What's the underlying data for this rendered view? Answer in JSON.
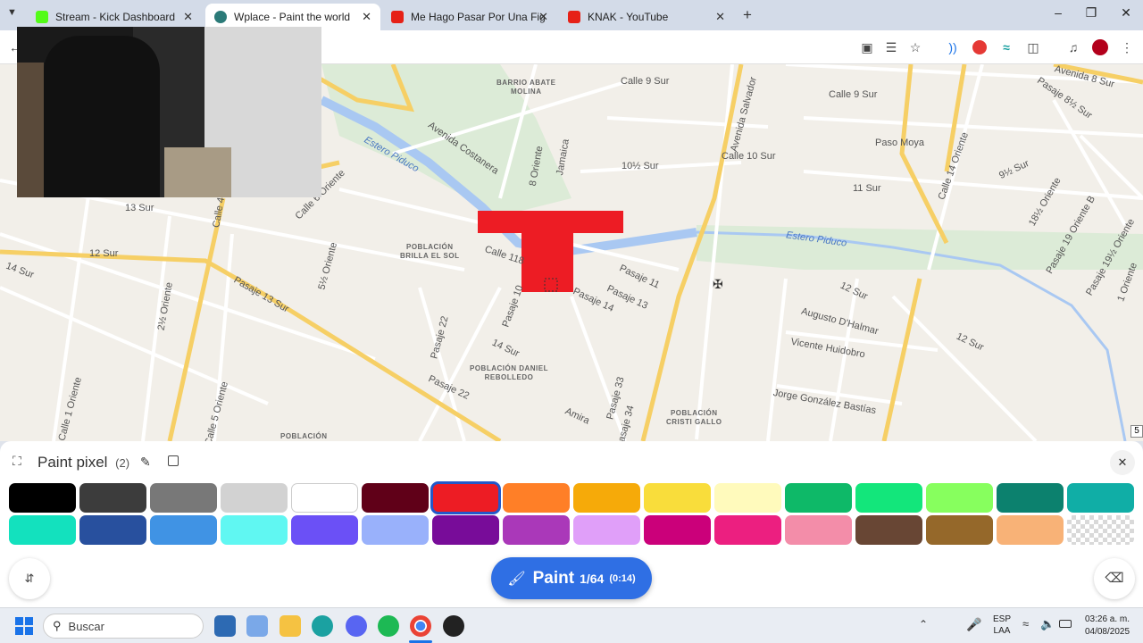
{
  "tabs": [
    {
      "title": "Stream - Kick Dashboard",
      "icon": "kick-icon",
      "color": "#53fc18",
      "active": false
    },
    {
      "title": "Wplace - Paint the world",
      "icon": "globe-icon",
      "color": "#2b7a78",
      "active": true
    },
    {
      "title": "Me Hago Pasar Por Una Figura",
      "icon": "youtube-icon",
      "color": "#e62117",
      "active": false
    },
    {
      "title": "KNAK - YouTube",
      "icon": "youtube-icon",
      "color": "#e62117",
      "active": false
    }
  ],
  "map": {
    "streets": [
      "Calle 9 Sur",
      "Calle 9 Sur",
      "Avenida 8 Sur",
      "Pasaje 8½ Sur",
      "Avenida Costanera",
      "8 Oriente",
      "Jamaica",
      "10½ Sur",
      "Calle 10 Sur",
      "Paso Moya",
      "Calle 14 Oriente",
      "9½ Sur",
      "11 Sur",
      "Calle 6 Oriente",
      "Calle 4",
      "13 Sur",
      "12 Sur",
      "Calle 118",
      "5½ Oriente",
      "Pasaje 13 Sur",
      "2½ Oriente",
      "14 Sur",
      "Pasaje 10",
      "Pasaje 14",
      "Pasaje 11",
      "Pasaje 13",
      "12 Sur",
      "Augusto D'Halmar",
      "Vicente Huidobro",
      "Jorge González Bastías",
      "Pasaje 22",
      "14 Sur",
      "Pasaje 22",
      "Pasaje 33",
      "Amira",
      "Pasaje 34",
      "Calle 5 Oriente",
      "Calle 1 Oriente",
      "Estero Piduco",
      "Estero Piduco",
      "Avenida Salvador",
      "18½ Oriente",
      "Pasaje 19 Oriente B",
      "Pasaje 19½ Oriente",
      "1 Oriente",
      "12 Sur"
    ],
    "neighborhoods": [
      "BARRIO ABATE\nMOLINA",
      "POBLACIÓN\nBRILLA EL SOL",
      "POBLACIÓN DANIEL\nREBOLLEDO",
      "POBLACIÓN\nCRISTI GALLO",
      "POBLACIÓN"
    ],
    "edge_badge": "5"
  },
  "panel": {
    "title": "Paint pixel",
    "count": "(2)",
    "palette_row1": [
      "#000000",
      "#3c3c3c",
      "#787878",
      "#d2d2d2",
      "#ffffff",
      "#600018",
      "#ed1c24",
      "#ff7f27",
      "#f6aa09",
      "#f9dd3b",
      "#fffabc",
      "#0eb968",
      "#13e67b",
      "#87ff5e",
      "#0c816e",
      "#10aea6"
    ],
    "palette_row2": [
      "#13e1be",
      "#28509e",
      "#4093e4",
      "#60f7f2",
      "#6b50f6",
      "#99b1fb",
      "#780c99",
      "#aa38b9",
      "#e09ff9",
      "#cb007a",
      "#ec1f80",
      "#f38da9",
      "#684634",
      "#95682a",
      "#f8b277",
      "transparent"
    ],
    "selected_index": 6,
    "paint_label": "Paint",
    "paint_counter": "1/64",
    "paint_timer": "(0:14)"
  },
  "taskbar": {
    "search_placeholder": "Buscar",
    "lang_top": "ESP",
    "lang_bottom": "LAA",
    "time": "03:26 a. m.",
    "date": "04/08/2025"
  }
}
